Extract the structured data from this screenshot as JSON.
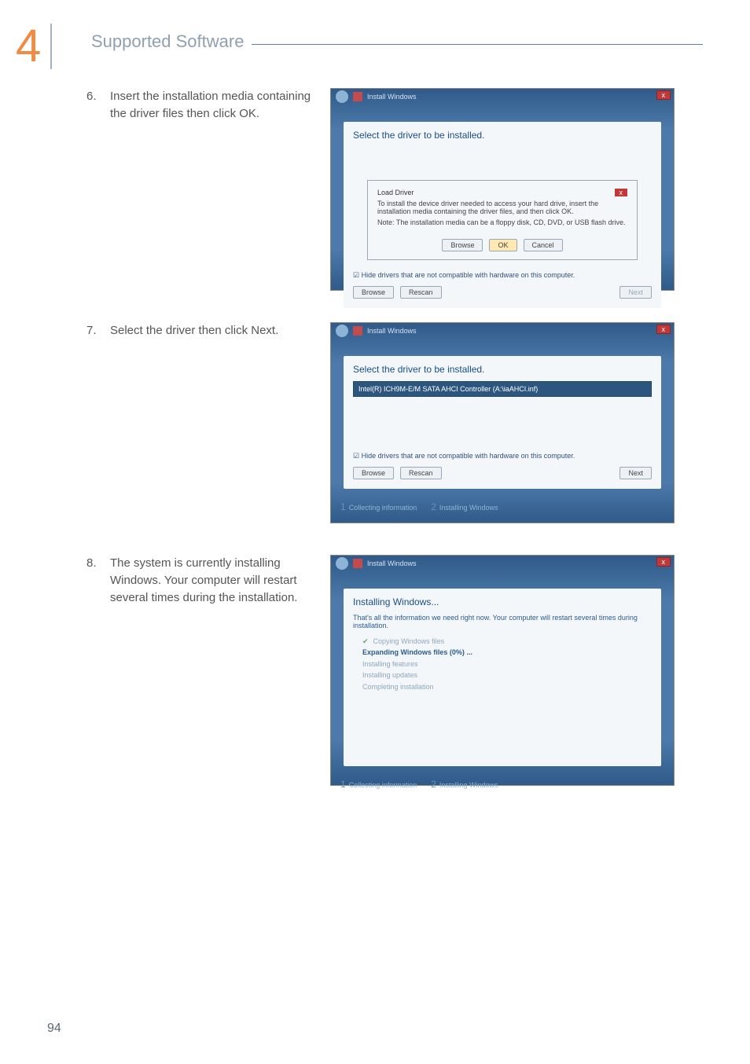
{
  "chapter_num": "4",
  "section_title": "Supported Software",
  "page_number": "94",
  "steps": [
    {
      "num": "6.",
      "text": "Insert the installation media containing the driver files then click OK."
    },
    {
      "num": "7.",
      "text": "Select the driver then click Next."
    },
    {
      "num": "8.",
      "text": "The system is currently installing Windows. Your computer will restart several times during the installation."
    }
  ],
  "dlg_common": {
    "window_title": "Install Windows",
    "panel_title": "Select the driver to be installed.",
    "hide_checkbox": "Hide drivers that are not compatible with hardware on this computer.",
    "browse": "Browse",
    "rescan": "Rescan",
    "next": "Next",
    "step1": "Collecting information",
    "step2": "Installing Windows"
  },
  "shot6": {
    "popup_title": "Load Driver",
    "line1": "To install the device driver needed to access your hard drive, insert the installation media containing the driver files, and then click OK.",
    "line2": "Note: The installation media can be a floppy disk, CD, DVD, or USB flash drive.",
    "browse": "Browse",
    "ok": "OK",
    "cancel": "Cancel"
  },
  "shot7": {
    "driver_item": "Intel(R) ICH9M-E/M SATA AHCI Controller (A:\\iaAHCI.inf)"
  },
  "shot8": {
    "title": "Installing Windows...",
    "subtitle": "That's all the information we need right now. Your computer will restart several times during installation.",
    "items": [
      "Copying Windows files",
      "Expanding Windows files (0%) ...",
      "Installing features",
      "Installing updates",
      "Completing installation"
    ]
  }
}
